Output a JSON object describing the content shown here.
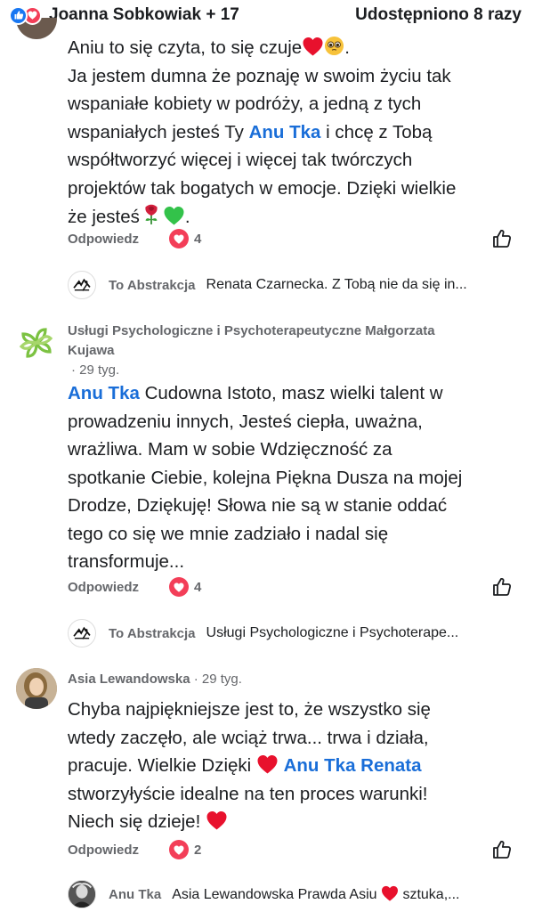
{
  "header": {
    "names": "Joanna Sobkowiak + 17",
    "shares": "Udostępniono 8 razy",
    "colors": {
      "like": "#1877f2",
      "love": "#f33e58"
    }
  },
  "reply_label": "Odpowiedz",
  "comments": [
    {
      "text_lines": [
        "Aniu to się czyta, to się czuje",
        "Ja jestem dumna że poznaję w swoim życiu tak",
        "wspaniałe kobiety w podróży, a jedną z tych",
        "wspaniałych jesteś Ty",
        "Anu Tka",
        "i chcę z Tobą",
        "współtworzyć więcej i więcej tak twórczych",
        "projektów tak bogatych w emocje. Dzięki wielkie",
        "że jesteś",
        "."
      ],
      "reactions": "4",
      "reply": {
        "name": "To Abstrakcja",
        "text": "Renata Czarnecka. Z Tobą nie da się in..."
      }
    },
    {
      "author_line1": "Usługi Psychologiczne i Psychoterapeutyczne Małgorzata",
      "author_line2": "Kujawa",
      "time": "· 29 tyg.",
      "text_lines": [
        "Anu Tka",
        "Cudowna Istoto, masz wielki talent w",
        "prowadzeniu innych, Jesteś ciepła, uważna,",
        "wrażliwa. Mam w sobie Wdzięczność za",
        "spotkanie Ciebie,  kolejna Piękna Dusza na mojej",
        "Drodze, Dziękuję! Słowa nie są w stanie oddać",
        "tego co się we mnie zadziało i nadal się",
        "transformuje..."
      ],
      "reactions": "4",
      "reply": {
        "name": "To Abstrakcja",
        "text": "Usługi Psychologiczne i Psychoterape..."
      }
    },
    {
      "author": "Asia Lewandowska",
      "time": "· 29 tyg.",
      "text_lines": [
        "Chyba najpiękniejsze jest to, że wszystko się",
        "wtedy zaczęło, ale wciąż trwa... trwa i działa,",
        "pracuje. Wielkie Dzięki",
        "Anu Tka Renata",
        "stworzyłyście idealne na ten proces warunki!",
        "Niech się dzieje!"
      ],
      "reactions": "2",
      "reply": {
        "name": "Anu Tka",
        "text_before": "Asia Lewandowska Prawda Asiu",
        "text_after": "sztuka,..."
      }
    }
  ]
}
